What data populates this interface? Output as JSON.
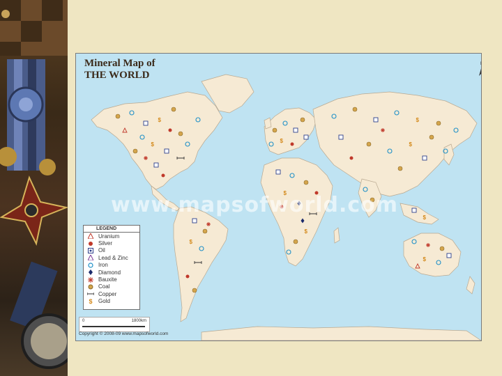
{
  "map": {
    "title_line1": "Mineral Map of",
    "title_line2": "THE WORLD",
    "north_label": "N",
    "watermark": "www.mapsofworld.com",
    "copyright": "Copyright © 2008-09 www.mapsofworld.com",
    "scale": {
      "start": "0",
      "end": "1800km"
    },
    "legend": {
      "title": "LEGEND",
      "items": [
        {
          "label": "Uranium",
          "icon": "uranium-icon"
        },
        {
          "label": "Silver",
          "icon": "silver-icon"
        },
        {
          "label": "Oil",
          "icon": "oil-icon"
        },
        {
          "label": "Lead & Zinc",
          "icon": "lead-zinc-icon"
        },
        {
          "label": "Iron",
          "icon": "iron-icon"
        },
        {
          "label": "Diamond",
          "icon": "diamond-icon"
        },
        {
          "label": "Bauxite",
          "icon": "bauxite-icon"
        },
        {
          "label": "Coal",
          "icon": "coal-icon"
        },
        {
          "label": "Copper",
          "icon": "copper-icon"
        },
        {
          "label": "Gold",
          "icon": "gold-icon"
        }
      ]
    },
    "colors": {
      "ocean": "#bfe3f2",
      "land": "#f6ead4",
      "border": "#b8a890",
      "water_text": "#ffffff"
    }
  }
}
